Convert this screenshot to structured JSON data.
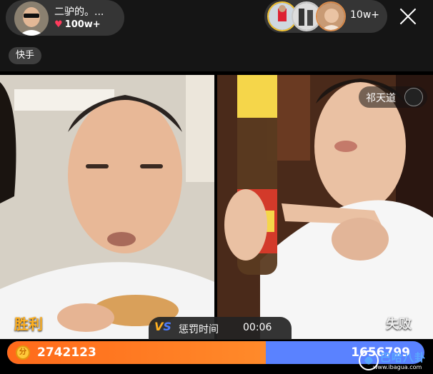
{
  "header": {
    "host_name": "二驴的。...",
    "likes": "100w+",
    "viewer_count": "10w+",
    "platform_badge": "快手"
  },
  "battle": {
    "left_result": "胜利",
    "right_result": "失败",
    "opponent_name": "祁天道",
    "timer_label": "惩罚时间",
    "timer_value": "00:06",
    "vs_label_v": "V",
    "vs_label_s": "S",
    "left_score": "2742123",
    "right_score": "1656799",
    "left_score_share": 0.62,
    "coin_icon_glyph": "分"
  },
  "colors": {
    "accent_orange": "#ff6a1a",
    "accent_blue": "#5a82ff",
    "win_text": "#ffb020",
    "heart": "#ff3b5c"
  },
  "watermark": {
    "brand_text": "巴哈八卦",
    "url": "www.ibagua.com"
  },
  "icons": {
    "heart": "heart-icon",
    "close": "close-icon",
    "vs": "vs-icon",
    "coin": "coin-icon"
  }
}
